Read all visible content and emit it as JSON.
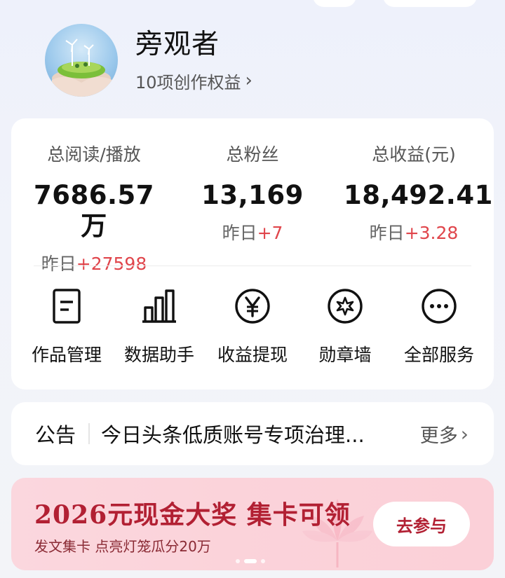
{
  "profile": {
    "username": "旁观者",
    "rights_label": "10项创作权益",
    "chevron": "›"
  },
  "stats": [
    {
      "label": "总阅读/播放",
      "value": "7686.57万",
      "yesterday_prefix": "昨日",
      "yesterday_delta": "+27598"
    },
    {
      "label": "总粉丝",
      "value": "13,169",
      "yesterday_prefix": "昨日",
      "yesterday_delta": "+7"
    },
    {
      "label": "总收益(元)",
      "value": "18,492.41",
      "yesterday_prefix": "昨日",
      "yesterday_delta": "+3.28"
    }
  ],
  "services": [
    {
      "label": "作品管理",
      "icon": "document-icon"
    },
    {
      "label": "数据助手",
      "icon": "bar-chart-icon"
    },
    {
      "label": "收益提现",
      "icon": "yuan-icon"
    },
    {
      "label": "勋章墙",
      "icon": "star-badge-icon"
    },
    {
      "label": "全部服务",
      "icon": "more-dots-icon"
    }
  ],
  "notice": {
    "tag": "公告",
    "text": "今日头条低质账号专项治理...",
    "more_label": "更多",
    "chevron": "›"
  },
  "banner": {
    "title": "2026元现金大奖 集卡可领",
    "subtitle": "发文集卡 点亮灯笼瓜分20万",
    "button_label": "去参与",
    "page_count": 3,
    "active_page": 2
  },
  "colors": {
    "delta_red": "#e0454b",
    "banner_accent": "#b22033",
    "banner_bg": "#fbd3da"
  }
}
